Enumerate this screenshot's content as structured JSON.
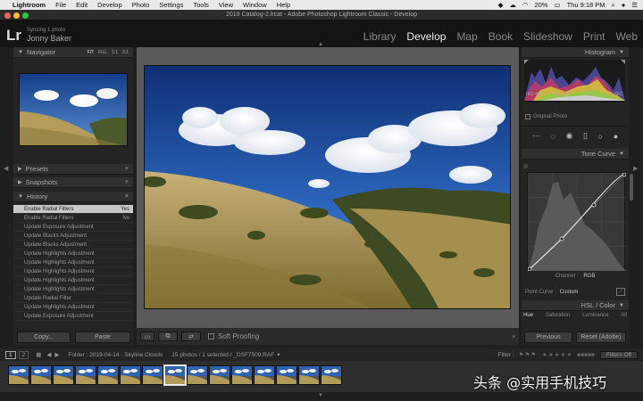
{
  "menubar": {
    "app": "Lightroom",
    "items": [
      "File",
      "Edit",
      "Develop",
      "Photo",
      "Settings",
      "Tools",
      "View",
      "Window",
      "Help"
    ],
    "battery": "20%",
    "time": "Thu 9:18 PM"
  },
  "window_title": "2019 Catalog-2.lrcat - Adobe Photoshop Lightroom Classic - Develop",
  "identity": {
    "logo": "Lr",
    "sync": "Syncing 1 photo",
    "user": "Jonny Baker",
    "modules": [
      "Library",
      "Develop",
      "Map",
      "Book",
      "Slideshow",
      "Print",
      "Web"
    ],
    "active_module": "Develop"
  },
  "left": {
    "navigator": {
      "title": "Navigator",
      "zoom": [
        "FIT",
        "FILL",
        "1:1",
        "3:1"
      ]
    },
    "presets": "Presets",
    "snapshots": "Snapshots",
    "history": {
      "title": "History",
      "items": [
        {
          "label": "Enable Radial Filters",
          "value": "Yes"
        },
        {
          "label": "Enable Radial Filters",
          "value": "No"
        },
        {
          "label": "Update Exposure Adjustment",
          "value": ""
        },
        {
          "label": "Update Blacks Adjustment",
          "value": ""
        },
        {
          "label": "Update Blacks Adjustment",
          "value": ""
        },
        {
          "label": "Update Highlights Adjustment",
          "value": ""
        },
        {
          "label": "Update Highlights Adjustment",
          "value": ""
        },
        {
          "label": "Update Highlights Adjustment",
          "value": ""
        },
        {
          "label": "Update Highlights Adjustment",
          "value": ""
        },
        {
          "label": "Update Highlights Adjustment",
          "value": ""
        },
        {
          "label": "Update Radial Filter",
          "value": ""
        },
        {
          "label": "Update Highlights Adjustment",
          "value": ""
        },
        {
          "label": "Update Exposure Adjustment",
          "value": ""
        }
      ]
    },
    "copy": "Copy...",
    "paste": "Paste"
  },
  "right": {
    "histogram": {
      "title": "Histogram",
      "iso": "ISO 400",
      "focal": "11.5 mm",
      "aperture": "f / 11",
      "shutter": "1/₁₆₀ SEC",
      "original": "Original Photo"
    },
    "tone_curve": {
      "title": "Tone Curve",
      "channel_label": "Channel :",
      "channel": "RGB",
      "point_curve_label": "Point Curve :",
      "point_curve": "Custom"
    },
    "hsl": {
      "title": "HSL / Color",
      "tabs": [
        "Hue",
        "Saturation",
        "Luminance",
        "All"
      ]
    },
    "previous": "Previous",
    "reset": "Reset (Adobe)"
  },
  "toolbar": {
    "soft_proofing": "Soft Proofing"
  },
  "filmstrip_bar": {
    "page1": "1",
    "page2": "2",
    "folder": "Folder : 2019-04-14 - Skyline Clouds",
    "count": "15 photos / 1 selected / _DSF7509.RAF",
    "filter": "Filter :",
    "filters_off": "Filters Off"
  },
  "watermark": "头条 @实用手机技巧",
  "colors": {
    "selected": "#c8c8c8",
    "panel": "#282828",
    "sky": "#1e4d9c",
    "grass": "#a08a4a"
  }
}
